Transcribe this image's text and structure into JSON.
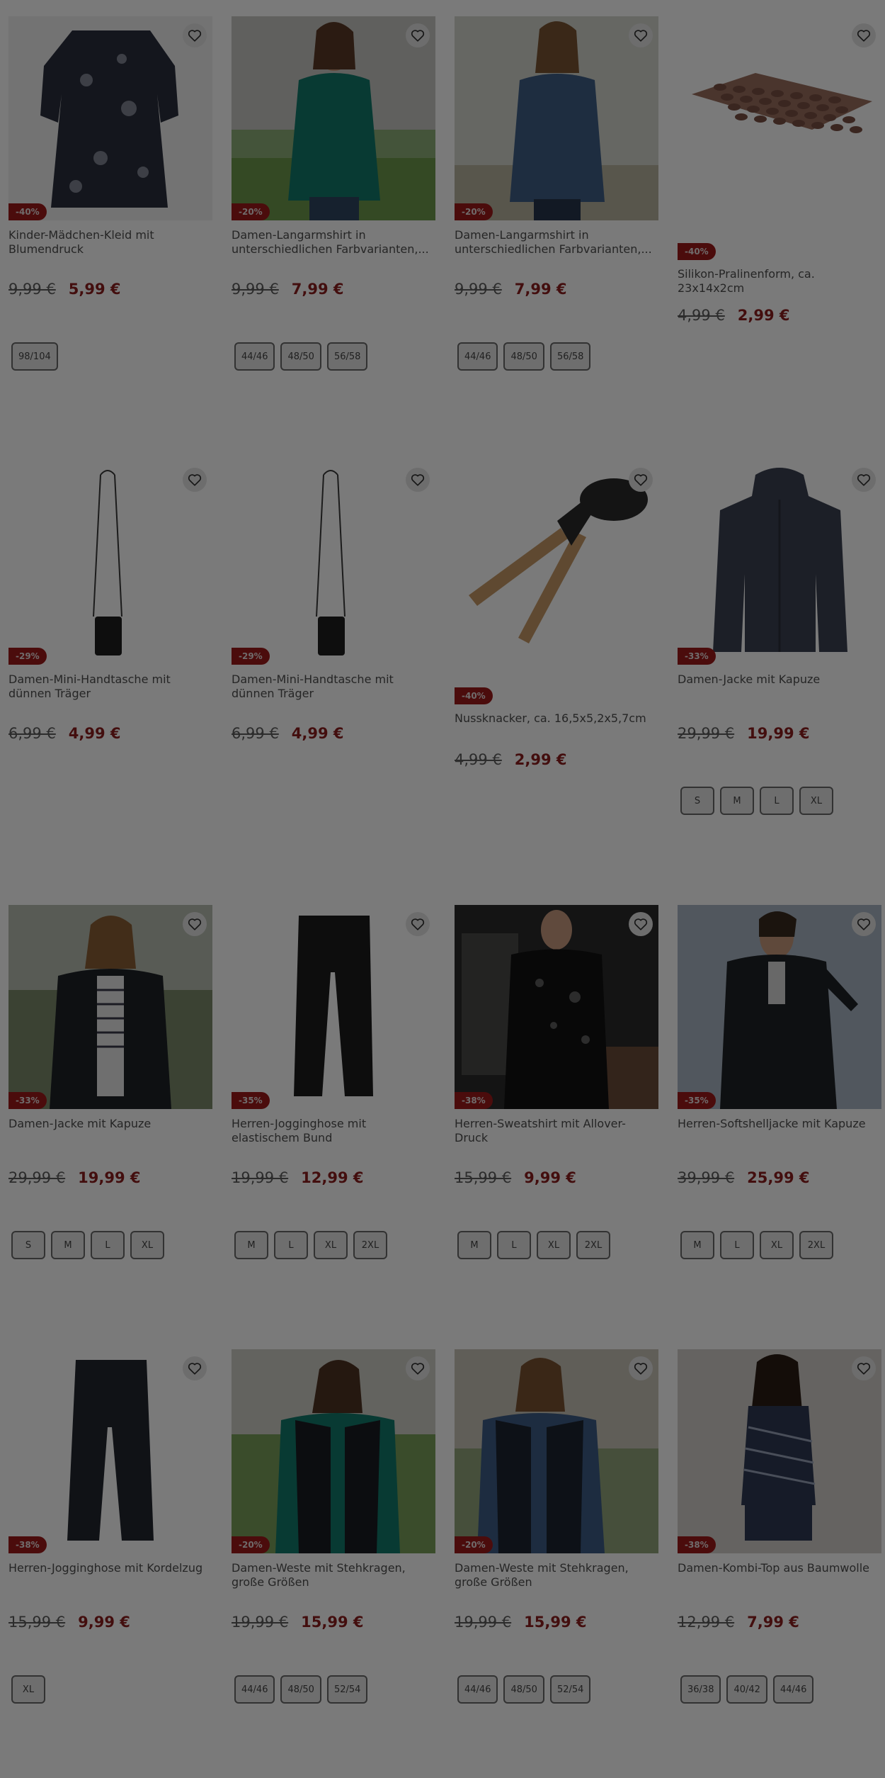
{
  "heart_icon": "heart-outline",
  "products": [
    {
      "name": "Kinder-Mädchen-Kleid mit Blumendruck",
      "badge": "-40%",
      "old": "9,99 €",
      "new": "5,99 €",
      "sizes": [
        "98/104"
      ],
      "img": "dress"
    },
    {
      "name": "Damen-Langarmshirt in unterschiedlichen Farbvarianten,...",
      "badge": "-20%",
      "old": "9,99 €",
      "new": "7,99 €",
      "sizes": [
        "44/46",
        "48/50",
        "56/58"
      ],
      "img": "woman-green"
    },
    {
      "name": "Damen-Langarmshirt in unterschiedlichen Farbvarianten,...",
      "badge": "-20%",
      "old": "9,99 €",
      "new": "7,99 €",
      "sizes": [
        "44/46",
        "48/50",
        "56/58"
      ],
      "img": "woman-blue"
    },
    {
      "name": "Silikon-Pralinenform, ca. 23x14x2cm",
      "badge": "-40%",
      "old": "4,99 €",
      "new": "2,99 €",
      "sizes": [],
      "img": "mold"
    },
    {
      "name": "Damen-Mini-Handtasche mit dünnen Träger",
      "badge": "-29%",
      "old": "6,99 €",
      "new": "4,99 €",
      "sizes": [],
      "img": "bag"
    },
    {
      "name": "Damen-Mini-Handtasche mit dünnen Träger",
      "badge": "-29%",
      "old": "6,99 €",
      "new": "4,99 €",
      "sizes": [],
      "img": "bag"
    },
    {
      "name": "Nussknacker, ca. 16,5x5,2x5,7cm",
      "badge": "-40%",
      "old": "4,99 €",
      "new": "2,99 €",
      "sizes": [],
      "img": "nutcracker"
    },
    {
      "name": "Damen-Jacke mit Kapuze",
      "badge": "-33%",
      "old": "29,99 €",
      "new": "19,99 €",
      "sizes": [
        "S",
        "M",
        "L",
        "XL"
      ],
      "img": "jacket"
    },
    {
      "name": "Damen-Jacke mit Kapuze",
      "badge": "-33%",
      "old": "29,99 €",
      "new": "19,99 €",
      "sizes": [
        "S",
        "M",
        "L",
        "XL"
      ],
      "img": "woman-jacket"
    },
    {
      "name": "Herren-Jogginghose mit elastischem Bund",
      "badge": "-35%",
      "old": "19,99 €",
      "new": "12,99 €",
      "sizes": [
        "M",
        "L",
        "XL",
        "2XL"
      ],
      "img": "pants"
    },
    {
      "name": "Herren-Sweatshirt mit Allover-Druck",
      "badge": "-38%",
      "old": "15,99 €",
      "new": "9,99 €",
      "sizes": [
        "M",
        "L",
        "XL",
        "2XL"
      ],
      "img": "man-sweat"
    },
    {
      "name": "Herren-Softshelljacke mit Kapuze",
      "badge": "-35%",
      "old": "39,99 €",
      "new": "25,99 €",
      "sizes": [
        "M",
        "L",
        "XL",
        "2XL"
      ],
      "img": "man-jacket"
    },
    {
      "name": "Herren-Jogginghose mit Kordelzug",
      "badge": "-38%",
      "old": "15,99 €",
      "new": "9,99 €",
      "sizes": [
        "XL"
      ],
      "img": "pants2"
    },
    {
      "name": "Damen-Weste mit Stehkragen, große Größen",
      "badge": "-20%",
      "old": "19,99 €",
      "new": "15,99 €",
      "sizes": [
        "44/46",
        "48/50",
        "52/54"
      ],
      "img": "woman-vest-green"
    },
    {
      "name": "Damen-Weste mit Stehkragen, große Größen",
      "badge": "-20%",
      "old": "19,99 €",
      "new": "15,99 €",
      "sizes": [
        "44/46",
        "48/50",
        "52/54"
      ],
      "img": "woman-vest-blue"
    },
    {
      "name": "Damen-Kombi-Top aus Baumwolle",
      "badge": "-38%",
      "old": "12,99 €",
      "new": "7,99 €",
      "sizes": [
        "36/38",
        "40/42",
        "44/46"
      ],
      "img": "woman-top"
    }
  ]
}
